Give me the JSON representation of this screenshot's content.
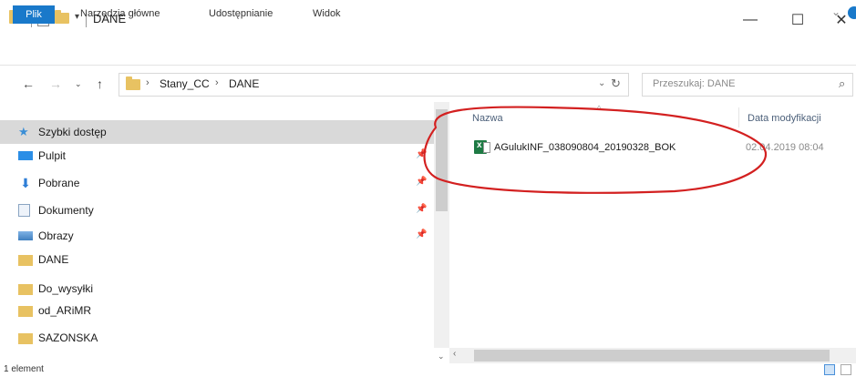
{
  "window": {
    "title": "DANE",
    "minimize_glyph": "—",
    "maximize_glyph": "☐",
    "close_glyph": "✕"
  },
  "ribbon": {
    "tabs": [
      "Plik",
      "Narzędzia główne",
      "Udostępnianie",
      "Widok"
    ]
  },
  "address": {
    "breadcrumbs": [
      "Stany_CC",
      "DANE"
    ],
    "crumb_separator": "›",
    "search_placeholder": "Przeszukaj: DANE"
  },
  "nav_pane": {
    "items": [
      {
        "label": "Szybki dostęp",
        "icon": "star-icon",
        "selected": true,
        "pinned": false
      },
      {
        "label": "Pulpit",
        "icon": "desktop-icon",
        "selected": false,
        "pinned": true
      },
      {
        "label": "Pobrane",
        "icon": "download-icon",
        "selected": false,
        "pinned": true
      },
      {
        "label": "Dokumenty",
        "icon": "documents-icon",
        "selected": false,
        "pinned": true
      },
      {
        "label": "Obrazy",
        "icon": "pictures-icon",
        "selected": false,
        "pinned": true
      },
      {
        "label": "DANE",
        "icon": "folder-icon",
        "selected": false,
        "pinned": false
      },
      {
        "label": "Do_wysyłki",
        "icon": "folder-icon",
        "selected": false,
        "pinned": false
      },
      {
        "label": "od_ARiMR",
        "icon": "folder-icon",
        "selected": false,
        "pinned": false
      },
      {
        "label": "SAZONSKA",
        "icon": "folder-icon",
        "selected": false,
        "pinned": false
      }
    ]
  },
  "file_list": {
    "columns": [
      "Nazwa",
      "Data modyfikacji"
    ],
    "rows": [
      {
        "name": "AGulukINF_038090804_20190328_BOK",
        "modified": "02.04.2019 08:04",
        "icon": "excel-icon"
      }
    ]
  },
  "status": {
    "text": "1 element"
  },
  "colors": {
    "accent": "#1979ca",
    "selection": "#d9d9d9",
    "annotation": "#d32020",
    "folder": "#e8c262"
  }
}
